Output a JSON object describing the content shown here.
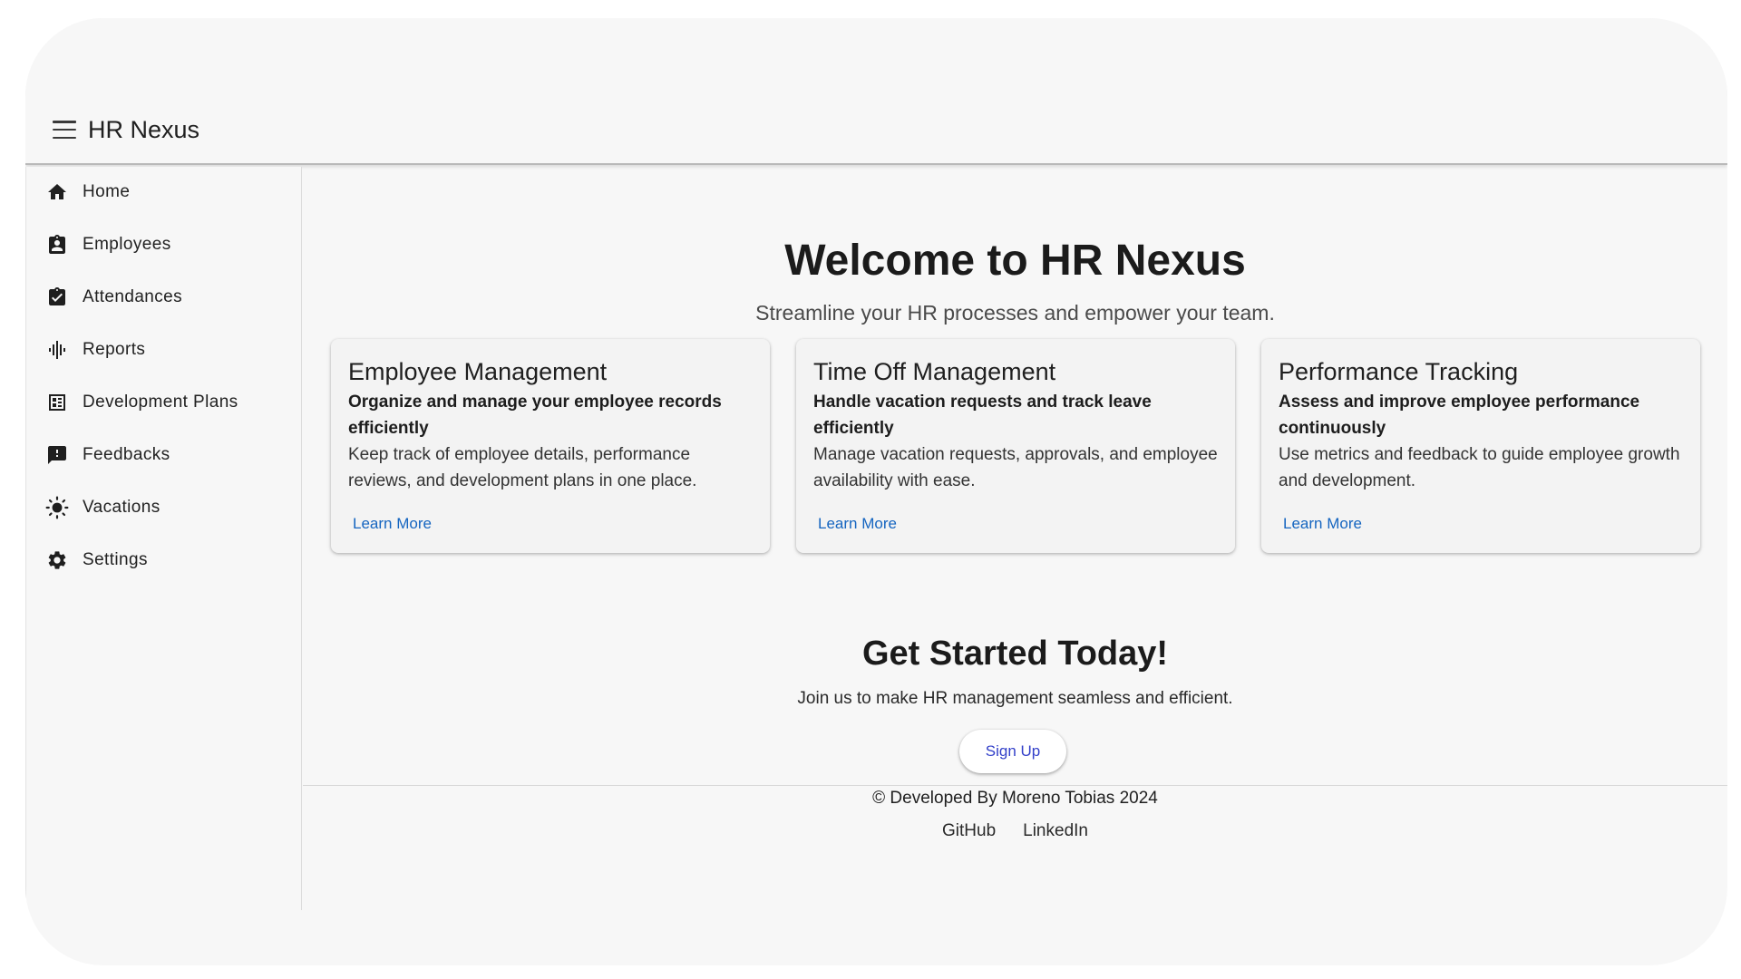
{
  "app": {
    "title": "HR Nexus",
    "menu_icon": "menu-icon"
  },
  "sidebar": {
    "items": [
      {
        "label": "Home",
        "icon": "home-icon"
      },
      {
        "label": "Employees",
        "icon": "badge-icon"
      },
      {
        "label": "Attendances",
        "icon": "assignment-check-icon"
      },
      {
        "label": "Reports",
        "icon": "graphic-eq-icon"
      },
      {
        "label": "Development Plans",
        "icon": "dashboard-icon"
      },
      {
        "label": "Feedbacks",
        "icon": "feedback-icon"
      },
      {
        "label": "Vacations",
        "icon": "sun-icon"
      },
      {
        "label": "Settings",
        "icon": "gear-icon"
      }
    ]
  },
  "main": {
    "title": "Welcome to HR Nexus",
    "subtitle": "Streamline your HR processes and empower your team.",
    "cards": [
      {
        "title": "Employee Management",
        "subtitle": "Organize and manage your employee records efficiently",
        "body": "Keep track of employee details, performance reviews, and development plans in one place.",
        "link": "Learn More"
      },
      {
        "title": "Time Off Management",
        "subtitle": "Handle vacation requests and track leave efficiently",
        "body": "Manage vacation requests, approvals, and employee availability with ease.",
        "link": "Learn More"
      },
      {
        "title": "Performance Tracking",
        "subtitle": "Assess and improve employee performance continuously",
        "body": "Use metrics and feedback to guide employee growth and development.",
        "link": "Learn More"
      }
    ],
    "cta": {
      "title": "Get Started Today!",
      "text": "Join us to make HR management seamless and efficient.",
      "button": "Sign Up"
    }
  },
  "footer": {
    "copyright": "© Developed By Moreno Tobias 2024",
    "links": [
      "GitHub",
      "LinkedIn"
    ]
  },
  "colors": {
    "background": "#f7f7f7",
    "link": "#1565c0",
    "signup_text": "#3340c9"
  }
}
